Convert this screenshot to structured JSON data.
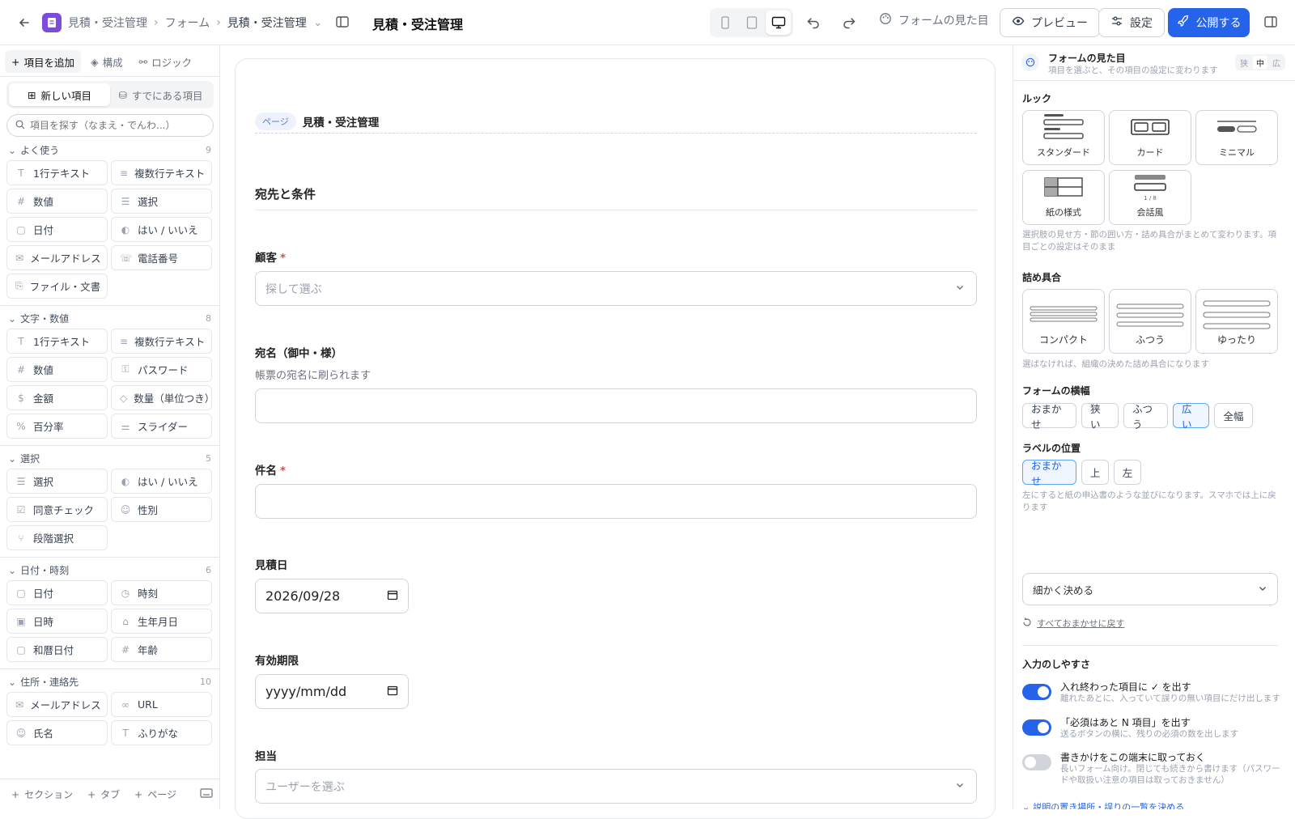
{
  "topbar": {
    "crumbs": [
      "見積・受注管理",
      "フォーム",
      "見積・受注管理"
    ],
    "title": "見積・受注管理",
    "look_label": "フォームの見た目",
    "preview_label": "プレビュー",
    "settings_label": "設定",
    "publish_label": "公開する",
    "accent": "#2563eb",
    "app_color": "#7c4ddb"
  },
  "left": {
    "tabs": [
      "項目を追加",
      "構成",
      "ロジック"
    ],
    "segments": [
      "新しい項目",
      "すでにある項目"
    ],
    "search_placeholder": "項目を探す（なまえ・でんわ...）",
    "categories": [
      {
        "name": "よく使う",
        "count": "9",
        "items": [
          {
            "label": "1行テキスト",
            "icon": "T"
          },
          {
            "label": "複数行テキスト",
            "icon": "≡"
          },
          {
            "label": "数値",
            "icon": "#"
          },
          {
            "label": "選択",
            "icon": "☰"
          },
          {
            "label": "日付",
            "icon": "▢"
          },
          {
            "label": "はい / いいえ",
            "icon": "◐"
          },
          {
            "label": "メールアドレス",
            "icon": "✉"
          },
          {
            "label": "電話番号",
            "icon": "☏"
          },
          {
            "label": "ファイル・文書",
            "icon": "⎘"
          }
        ]
      },
      {
        "name": "文字・数値",
        "count": "8",
        "items": [
          {
            "label": "1行テキスト",
            "icon": "T"
          },
          {
            "label": "複数行テキスト",
            "icon": "≡"
          },
          {
            "label": "数値",
            "icon": "#"
          },
          {
            "label": "パスワード",
            "icon": "⚿"
          },
          {
            "label": "金額",
            "icon": "$"
          },
          {
            "label": "数量（単位つき）",
            "icon": "◇"
          },
          {
            "label": "百分率",
            "icon": "%"
          },
          {
            "label": "スライダー",
            "icon": "⚌"
          }
        ]
      },
      {
        "name": "選択",
        "count": "5",
        "items": [
          {
            "label": "選択",
            "icon": "☰"
          },
          {
            "label": "はい / いいえ",
            "icon": "◐"
          },
          {
            "label": "同意チェック",
            "icon": "☑"
          },
          {
            "label": "性別",
            "icon": "☺"
          },
          {
            "label": "段階選択",
            "icon": "⑂"
          }
        ]
      },
      {
        "name": "日付・時刻",
        "count": "6",
        "items": [
          {
            "label": "日付",
            "icon": "▢"
          },
          {
            "label": "時刻",
            "icon": "◷"
          },
          {
            "label": "日時",
            "icon": "▣"
          },
          {
            "label": "生年月日",
            "icon": "⌂"
          },
          {
            "label": "和暦日付",
            "icon": "▢"
          },
          {
            "label": "年齢",
            "icon": "#"
          }
        ]
      },
      {
        "name": "住所・連絡先",
        "count": "10",
        "items": [
          {
            "label": "メールアドレス",
            "icon": "✉"
          },
          {
            "label": "URL",
            "icon": "∞"
          },
          {
            "label": "氏名",
            "icon": "☺"
          },
          {
            "label": "ふりがな",
            "icon": "T"
          }
        ]
      }
    ],
    "footer": [
      "セクション",
      "タブ",
      "ページ"
    ]
  },
  "form": {
    "page_badge": "ページ",
    "page_title": "見積・受注管理",
    "section_title": "宛先と条件",
    "fields": [
      {
        "label": "顧客",
        "required": "*",
        "placeholder": "探して選ぶ"
      },
      {
        "label": "宛名（御中・様）",
        "desc": "帳票の宛名に刷られます"
      },
      {
        "label": "件名",
        "required": "*"
      },
      {
        "label": "見積日",
        "value": "2026/09/28"
      },
      {
        "label": "有効期限",
        "value": "yyyy/mm/dd"
      },
      {
        "label": "担当",
        "placeholder": "ユーザーを選ぶ"
      }
    ]
  },
  "right": {
    "title": "フォームの見た目",
    "subtitle": "項目を選ぶと、その項目の設定に変わります",
    "sizes": [
      "狭",
      "中",
      "広"
    ],
    "look_label": "ルック",
    "looks": [
      "スタンダード",
      "カード",
      "ミニマル",
      "紙の様式",
      "会話風"
    ],
    "look_note": "選択肢の見せ方・節の囲い方・詰め具合がまとめて変わります。項目ごとの設定はそのまま",
    "density_label": "詰め具合",
    "densities": [
      "コンパクト",
      "ふつう",
      "ゆったり"
    ],
    "density_note": "選ばなければ、組織の決めた詰め具合になります",
    "width_label": "フォームの横幅",
    "widths": [
      "おまかせ",
      "狭い",
      "ふつう",
      "広い",
      "全幅"
    ],
    "labelpos_label": "ラベルの位置",
    "labelpos": [
      "おまかせ",
      "上",
      "左"
    ],
    "labelpos_note": "左にすると紙の申込書のような並びになります。スマホでは上に戻ります",
    "detail_select": "細かく決める",
    "reset_label": "すべておまかせに戻す",
    "ease_label": "入力のしやすさ",
    "toggles": [
      {
        "title": "入れ終わった項目に ✓ を出す",
        "desc": "離れたあとに、入っていて誤りの無い項目にだけ出します",
        "on": true
      },
      {
        "title": "「必須はあと N 項目」を出す",
        "desc": "送るボタンの横に、残りの必須の数を出します",
        "on": true
      },
      {
        "title": "書きかけをこの端末に取っておく",
        "desc": "長いフォーム向け。閉じても続きから書けます（パスワードや取扱い注意の項目は取っておきません）",
        "on": false
      }
    ],
    "more_label": "説明の置き場所・誤りの一覧を決める"
  }
}
